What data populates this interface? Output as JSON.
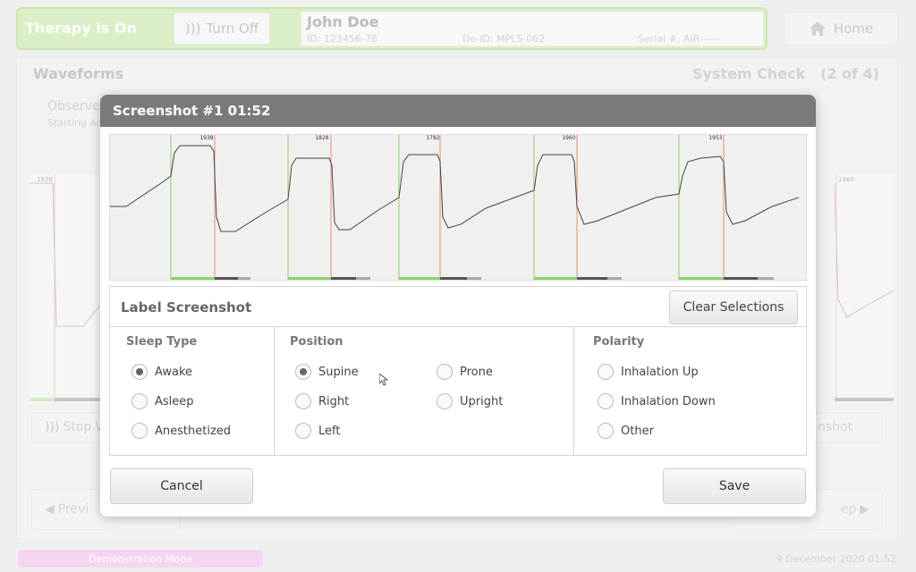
{
  "topbar": {
    "therapy_status": "Therapy is On",
    "turn_off_label": "Turn Off",
    "patient": {
      "name": "John Doe",
      "id": "ID: 123456-78",
      "de_id": "De-ID: MPLS-062",
      "serial": "Serial #: AIR------"
    },
    "home_label": "Home"
  },
  "background": {
    "panel_title": "Waveforms",
    "system_check": "System Check",
    "system_check_step": "(2 of 4)",
    "observe_text": "Observe",
    "starting_text": "Starting Ar",
    "stop_label": "Stop W",
    "screenshot_label": "nshot",
    "prev_label": "Previ",
    "next_label": "ep",
    "left_wave_value": "1938",
    "right_wave_value": "1960"
  },
  "footer": {
    "demo_mode": "Demonstration Mode",
    "datetime": "9 December 2020 01:52"
  },
  "dialog": {
    "title": "Screenshot #1 01:52",
    "breath_values": [
      "1938",
      "1828",
      "1782",
      "1960",
      "1953"
    ],
    "label_title": "Label Screenshot",
    "clear_label": "Clear Selections",
    "sleep_type": {
      "title": "Sleep Type",
      "options": [
        "Awake",
        "Asleep",
        "Anesthetized"
      ],
      "selected": "Awake"
    },
    "position": {
      "title": "Position",
      "options": [
        "Supine",
        "Right",
        "Left",
        "Prone",
        "Upright"
      ],
      "selected": "Supine"
    },
    "polarity": {
      "title": "Polarity",
      "options": [
        "Inhalation Up",
        "Inhalation Down",
        "Other"
      ],
      "selected": ""
    },
    "cancel_label": "Cancel",
    "save_label": "Save"
  },
  "colors": {
    "therapy_green": "#c8e6a8",
    "inhale_marker": "#8fd16a",
    "exhale_marker": "#e88a7a",
    "demo_pink": "#f0bfe8",
    "header_gray": "#7a7a7a"
  }
}
